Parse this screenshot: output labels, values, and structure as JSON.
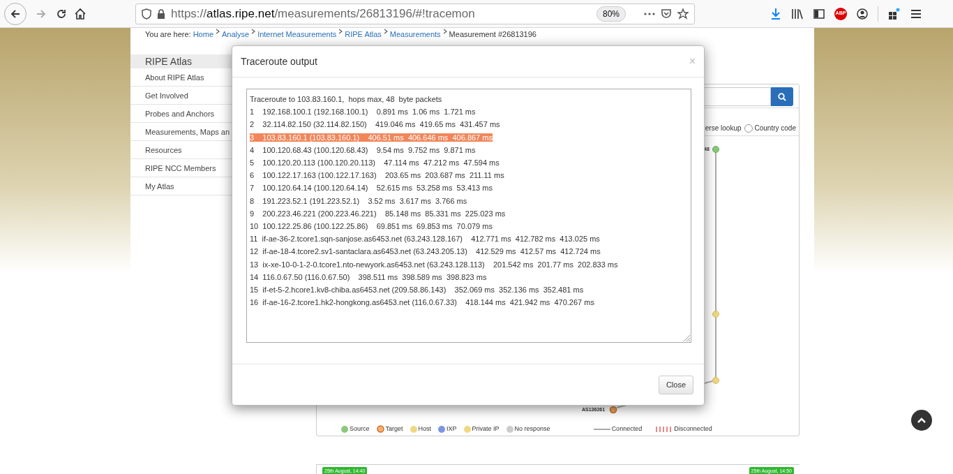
{
  "browser": {
    "url_scheme": "https://",
    "url_domain": "atlas.ripe.net",
    "url_path": "/measurements/26813196/#!tracemon",
    "zoom": "80%",
    "adblock_badge": "ABP"
  },
  "breadcrumb": {
    "prefix": "You are here:",
    "links": [
      "Home",
      "Analyse",
      "Internet Measurements",
      "RIPE Atlas",
      "Measurements"
    ],
    "current": "Measurement #26813196"
  },
  "sidebar": {
    "title": "RIPE Atlas",
    "items": [
      "About RIPE Atlas",
      "Get Involved",
      "Probes and Anchors",
      "Measurements, Maps an",
      "Resources",
      "RIPE NCC Members",
      "My Atlas"
    ]
  },
  "panel": {
    "options": [
      {
        "label": "erse lookup",
        "kind": "text"
      },
      {
        "label": "Country code",
        "kind": "radio",
        "checked": false
      }
    ],
    "graph_labels": {
      "top_node": "48",
      "target_node": "AS136261"
    },
    "legend": [
      {
        "label": "Source",
        "kind": "dot",
        "color": "#8cc97a"
      },
      {
        "label": "Target",
        "kind": "ring",
        "color": "#f5b272"
      },
      {
        "label": "Host",
        "kind": "dot",
        "color": "#f0d882"
      },
      {
        "label": "IXP",
        "kind": "dot",
        "color": "#7b95e0"
      },
      {
        "label": "Private IP",
        "kind": "dot",
        "color": "#f0d882"
      },
      {
        "label": "No response",
        "kind": "dot",
        "color": "#cccccc"
      },
      {
        "label": "Connected",
        "kind": "line",
        "color": "#aaaaaa"
      },
      {
        "label": "Disconnected",
        "kind": "dashed",
        "color": "#e88a8a"
      }
    ],
    "timeline": [
      "25th August, 14:40",
      "25th August, 14:50"
    ]
  },
  "modal": {
    "title": "Traceroute output",
    "close_glyph": "×",
    "lines": [
      {
        "text": "Traceroute to 103.83.160.1,  hops max, 48  byte packets",
        "selected": false
      },
      {
        "text": "1    192.168.100.1 (192.168.100.1)    0.891 ms  1.06 ms  1.721 ms",
        "selected": false
      },
      {
        "text": "2    32.114.82.150 (32.114.82.150)    419.046 ms  419.65 ms  431.457 ms",
        "selected": false
      },
      {
        "text": "3    103.83.160.1 (103.83.160.1)    406.51 ms  406.646 ms  406.867 ms",
        "selected": true
      },
      {
        "text": "4    100.120.68.43 (100.120.68.43)    9.54 ms  9.752 ms  9.871 ms",
        "selected": false
      },
      {
        "text": "5    100.120.20.113 (100.120.20.113)    47.114 ms  47.212 ms  47.594 ms",
        "selected": false
      },
      {
        "text": "6    100.122.17.163 (100.122.17.163)    203.65 ms  203.687 ms  211.11 ms",
        "selected": false
      },
      {
        "text": "7    100.120.64.14 (100.120.64.14)    52.615 ms  53.258 ms  53.413 ms",
        "selected": false
      },
      {
        "text": "8    191.223.52.1 (191.223.52.1)    3.52 ms  3.617 ms  3.766 ms",
        "selected": false
      },
      {
        "text": "9    200.223.46.221 (200.223.46.221)    85.148 ms  85.331 ms  225.023 ms",
        "selected": false
      },
      {
        "text": "10  100.122.25.86 (100.122.25.86)    69.851 ms  69.853 ms  70.079 ms",
        "selected": false
      },
      {
        "text": "11  if-ae-36-2.tcore1.sqn-sanjose.as6453.net (63.243.128.167)    412.771 ms  412.782 ms  413.025 ms",
        "selected": false
      },
      {
        "text": "12  if-ae-18-4.tcore2.sv1-santaclara.as6453.net (63.243.205.13)    412.529 ms  412.57 ms  412.724 ms",
        "selected": false
      },
      {
        "text": "13  ix-xe-10-0-1-2-0.tcore1.nto-newyork.as6453.net (63.243.128.113)    201.542 ms  201.77 ms  202.833 ms",
        "selected": false
      },
      {
        "text": "14  116.0.67.50 (116.0.67.50)    398.511 ms  398.589 ms  398.823 ms",
        "selected": false
      },
      {
        "text": "15  if-et-5-2.hcore1.kv8-chiba.as6453.net (209.58.86.143)    352.069 ms  352.136 ms  352.481 ms",
        "selected": false
      },
      {
        "text": "16  if-ae-16-2.tcore1.hk2-hongkong.as6453.net (116.0.67.33)    418.144 ms  421.942 ms  470.267 ms",
        "selected": false
      }
    ],
    "button": "Close"
  }
}
